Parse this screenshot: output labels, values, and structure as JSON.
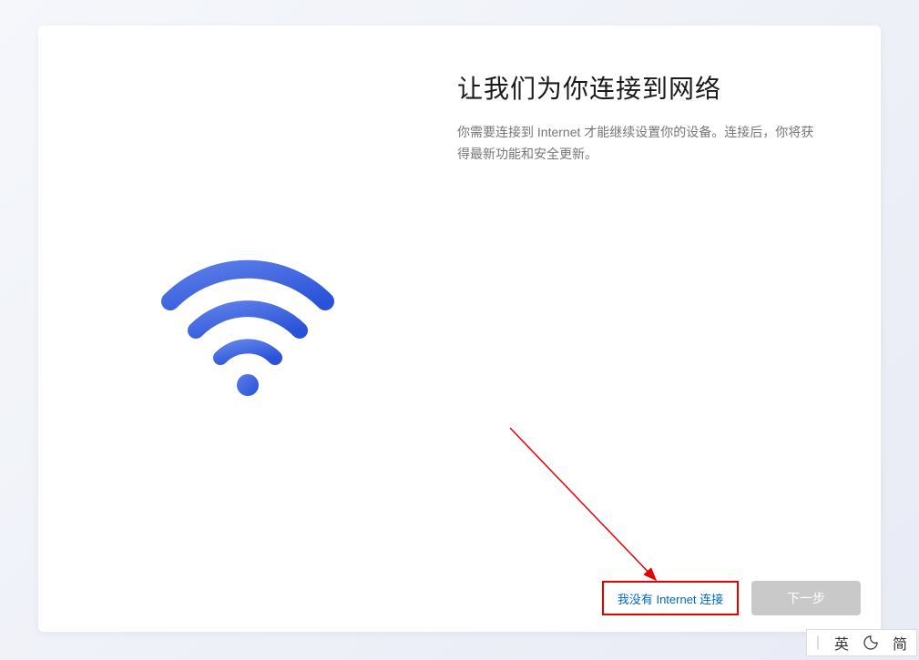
{
  "setup": {
    "title": "让我们为你连接到网络",
    "description": "你需要连接到 Internet 才能继续设置你的设备。连接后，你将获得最新功能和安全更新。"
  },
  "buttons": {
    "no_internet": "我没有 Internet 连接",
    "next": "下一步"
  },
  "ime": {
    "lang": "英",
    "mode": "简"
  },
  "colors": {
    "accent": "#0067c0",
    "wifi_gradient_start": "#5b7de8",
    "wifi_gradient_end": "#2a52d8",
    "annotation": "#e60000"
  }
}
